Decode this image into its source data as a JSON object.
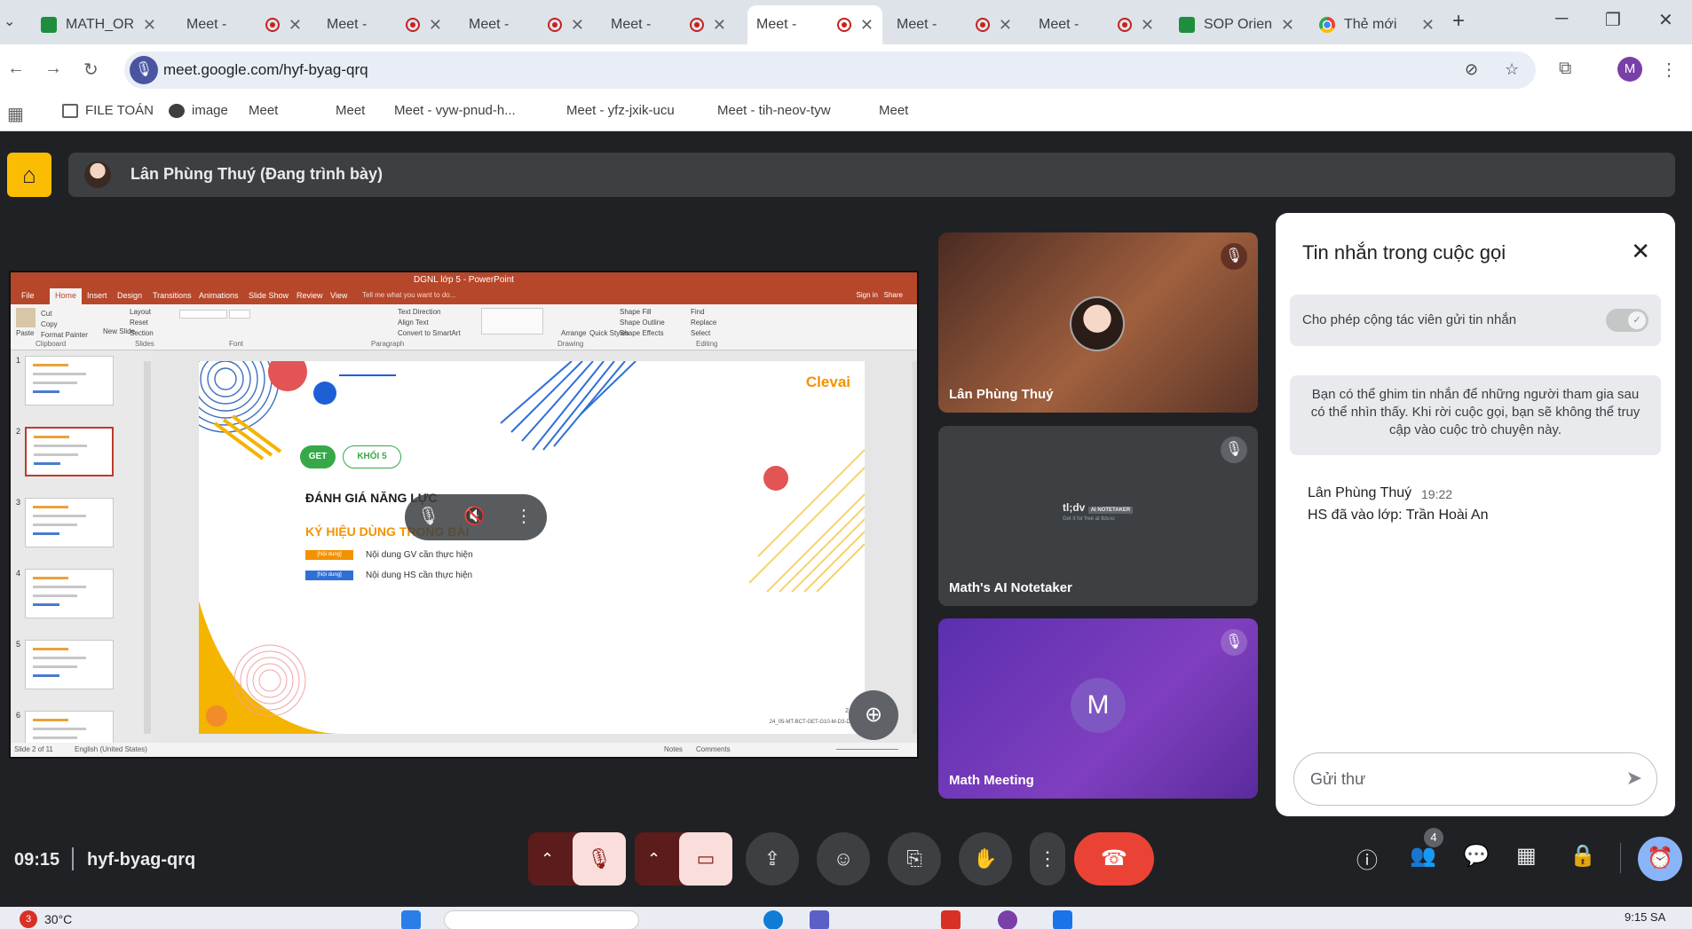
{
  "browser": {
    "tabs": [
      {
        "label": "MATH_ORI",
        "icon": "sheets-icon",
        "recording": false
      },
      {
        "label": "Meet -",
        "icon": "meet-icon",
        "recording": true
      },
      {
        "label": "Meet -",
        "icon": "meet-icon",
        "recording": true
      },
      {
        "label": "Meet -",
        "icon": "meet-icon",
        "recording": true
      },
      {
        "label": "Meet -",
        "icon": "meet-icon",
        "recording": true
      },
      {
        "label": "Meet -",
        "icon": "meet-icon",
        "recording": true,
        "active": true
      },
      {
        "label": "Meet -",
        "icon": "meet-icon",
        "recording": true
      },
      {
        "label": "Meet -",
        "icon": "meet-icon",
        "recording": true
      },
      {
        "label": "SOP Orien",
        "icon": "sheets-icon",
        "recording": false
      },
      {
        "label": "Thẻ mới",
        "icon": "chrome-icon",
        "recording": false
      }
    ],
    "url": "meet.google.com/hyf-byag-qrq",
    "profile_initial": "M",
    "bookmarks": [
      {
        "label": "FILE TOÁN",
        "icon": "folder-icon"
      },
      {
        "label": "image",
        "icon": "globe-icon"
      },
      {
        "label": "Meet",
        "icon": "meet-icon"
      },
      {
        "label": "Meet",
        "icon": "meet-icon"
      },
      {
        "label": "Meet - vyw-pnud-h...",
        "icon": "meet-icon"
      },
      {
        "label": "Meet - yfz-jxik-ucu",
        "icon": "meet-icon"
      },
      {
        "label": "Meet - tih-neov-tyw",
        "icon": "meet-icon"
      },
      {
        "label": "Meet",
        "icon": "meet-icon"
      }
    ]
  },
  "meet": {
    "presenter_label": "Lân Phùng Thuý (Đang trình bày)",
    "time": "09:15",
    "meeting_code": "hyf-byag-qrq",
    "participant_count": "4",
    "participants": [
      {
        "name": "Lân Phùng Thuý",
        "muted": true
      },
      {
        "name": "Math's AI Notetaker",
        "muted": true,
        "brand": "tl;dv",
        "brand_sub": "AI NOTETAKER",
        "brand_tag": "Get it for free at tldv.io"
      },
      {
        "name": "Math Meeting",
        "muted": true,
        "initial": "M"
      }
    ],
    "chat": {
      "title": "Tin nhắn trong cuộc gọi",
      "toggle_label": "Cho phép cộng tác viên gửi tin nhắn",
      "toggle_on": true,
      "info": "Bạn có thể ghim tin nhắn để những người tham gia sau có thể nhìn thấy. Khi rời cuộc gọi, bạn sẽ không thể truy cập vào cuộc trò chuyện này.",
      "messages": [
        {
          "sender": "Lân Phùng Thuý",
          "time": "19:22",
          "text": "HS đã vào lớp: Trần Hoài An"
        }
      ],
      "input_placeholder": "Gửi thư"
    }
  },
  "powerpoint": {
    "title": "DGNL lớp 5 - PowerPoint",
    "tabs": [
      "File",
      "Home",
      "Insert",
      "Design",
      "Transitions",
      "Animations",
      "Slide Show",
      "Review",
      "View"
    ],
    "tell_me": "Tell me what you want to do...",
    "sign_in": "Sign in",
    "share": "Share",
    "ribbon_groups": [
      "Clipboard",
      "Slides",
      "Font",
      "Paragraph",
      "Drawing",
      "Editing"
    ],
    "ribbon_items": {
      "paste": "Paste",
      "cut": "Cut",
      "copy": "Copy",
      "format_painter": "Format Painter",
      "new_slide": "New Slide",
      "layout": "Layout",
      "reset": "Reset",
      "section": "Section",
      "text_direction": "Text Direction",
      "align_text": "Align Text",
      "convert_smartart": "Convert to SmartArt",
      "arrange": "Arrange",
      "quick_styles": "Quick Styles",
      "shape_fill": "Shape Fill",
      "shape_outline": "Shape Outline",
      "shape_effects": "Shape Effects",
      "find": "Find",
      "replace": "Replace",
      "select": "Select"
    },
    "thumbs": [
      "1",
      "2",
      "3",
      "4",
      "5",
      "6"
    ],
    "selected_slide": 2,
    "status": {
      "slide": "Slide 2 of 11",
      "language": "English (United States)",
      "notes": "Notes",
      "comments": "Comments"
    },
    "slide": {
      "logo": "Clevai",
      "badge_get": "GET",
      "badge_grade": "KHỐI 5",
      "heading": "ĐÁNH GIÁ NĂNG LỰC",
      "subheading": "KÝ HIỆU DÙNG TRONG BÀI",
      "legend": [
        {
          "tag": "[Nội dung]",
          "text": "Nội dung GV cần thực hiện",
          "color": "#f39200"
        },
        {
          "tag": "[Nội dung]",
          "text": "Nội dung HS cần thực hiện",
          "color": "#2f6fd6"
        }
      ],
      "page_number": "2",
      "footer_code": "24_05-MT-BCT-GET-G10-M-D3-D13-C1"
    }
  },
  "taskbar": {
    "weather_badge": "3",
    "temperature": "30°C",
    "clock": "9:15 SA"
  }
}
